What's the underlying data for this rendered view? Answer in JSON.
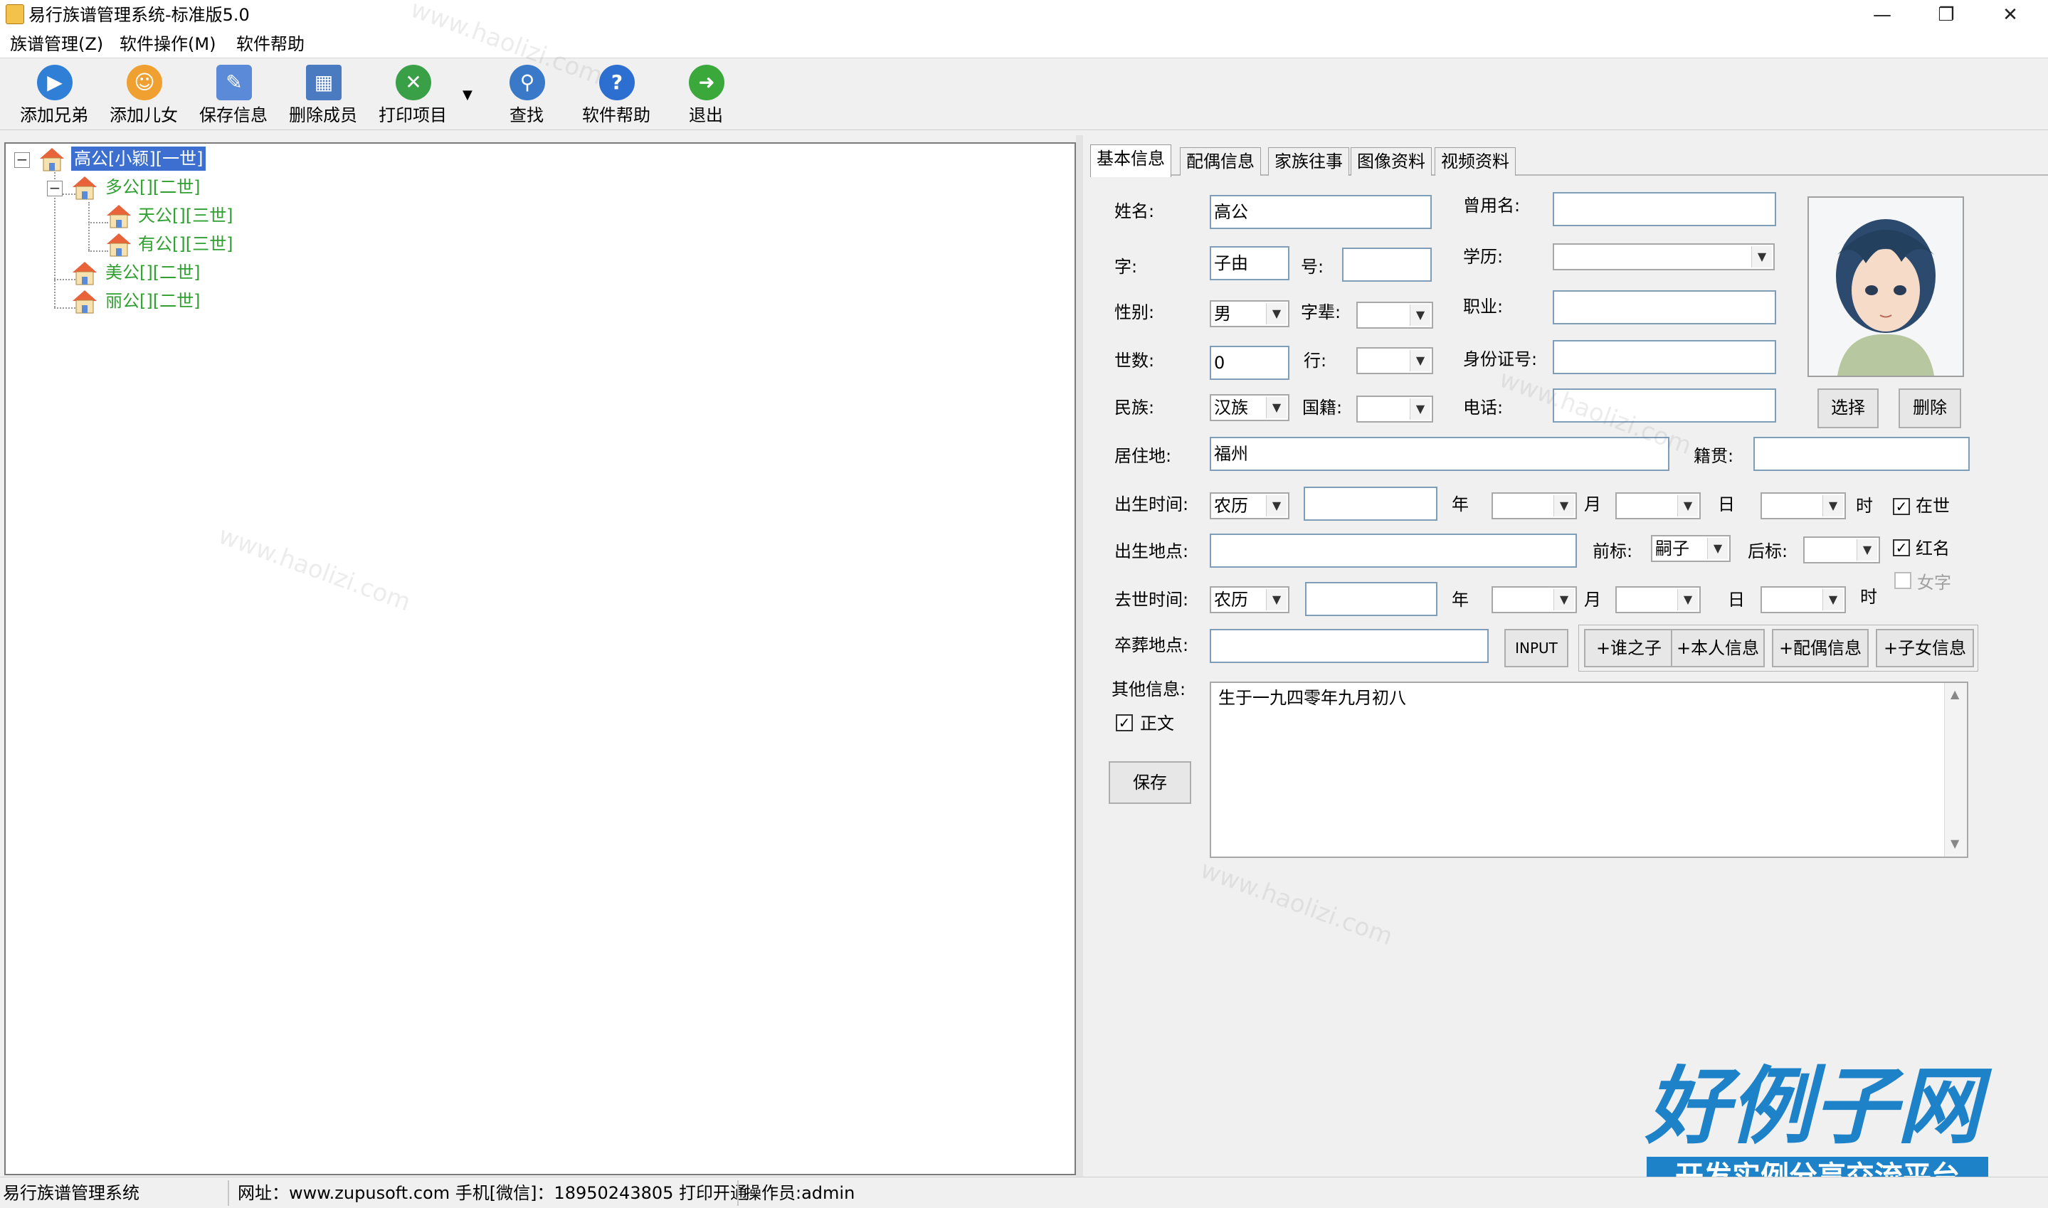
{
  "window": {
    "title": "易行族谱管理系统-标准版5.0"
  },
  "menu": [
    "族谱管理(Z)",
    "软件操作(M)",
    "软件帮助"
  ],
  "toolbar": {
    "buttons": [
      {
        "label": "添加兄弟",
        "icon": "play-circle-icon",
        "color": "#2f7fd6"
      },
      {
        "label": "添加儿女",
        "icon": "user-add-icon",
        "color": "#f0a030"
      },
      {
        "label": "保存信息",
        "icon": "edit-pencil-icon",
        "color": "#5a8ad8"
      },
      {
        "label": "删除成员",
        "icon": "grid-delete-icon",
        "color": "#4a7ac0"
      },
      {
        "label": "打印项目",
        "icon": "print-tools-icon",
        "color": "#3aa048"
      },
      {
        "label": "查找",
        "icon": "search-globe-icon",
        "color": "#3a78c8"
      },
      {
        "label": "软件帮助",
        "icon": "help-icon",
        "color": "#2d6fd0"
      },
      {
        "label": "退出",
        "icon": "exit-arrow-icon",
        "color": "#3aa83a"
      }
    ]
  },
  "tree": {
    "nodes": [
      {
        "label": "高公[小颖][一世]",
        "selected": true
      },
      {
        "label": "多公[][二世]"
      },
      {
        "label": "天公[][三世]"
      },
      {
        "label": "有公[][三世]"
      },
      {
        "label": "美公[][二世]"
      },
      {
        "label": "丽公[][二世]"
      }
    ]
  },
  "tabs": [
    "基本信息",
    "配偶信息",
    "家族往事",
    "图像资料",
    "视频资料"
  ],
  "form": {
    "labels": {
      "name": "姓名:",
      "used_name": "曾用名:",
      "zi": "字:",
      "hao": "号:",
      "education": "学历:",
      "gender": "性别:",
      "zibei": "字辈:",
      "job": "职业:",
      "generation": "世数:",
      "hang": "行:",
      "idcard": "身份证号:",
      "ethnic": "民族:",
      "nationality": "国籍:",
      "phone": "电话:",
      "residence": "居住地:",
      "native": "籍贯:",
      "birth_time": "出生时间:",
      "year": "年",
      "month": "月",
      "day": "日",
      "hour": "时",
      "alive": "在世",
      "birth_place": "出生地点:",
      "prefix": "前标:",
      "suffix": "后标:",
      "red_name": "红名",
      "female": "女字",
      "death_time": "去世时间:",
      "burial": "卒葬地点:",
      "other": "其他信息:",
      "main_text": "正文"
    },
    "values": {
      "name": "高公",
      "used_name": "",
      "zi": "子由",
      "hao": "",
      "education": "",
      "gender": "男",
      "zibei": "",
      "job": "",
      "generation": "0",
      "hang": "",
      "idcard": "",
      "ethnic": "汉族",
      "nationality": "",
      "phone": "",
      "residence": "福州",
      "native": "",
      "birth_calendar": "农历",
      "birth_date": "",
      "birth_year": "",
      "birth_month": "",
      "birth_day": "",
      "birth_hour": "",
      "birth_place": "",
      "prefix": "嗣子",
      "suffix": "",
      "death_calendar": "农历",
      "death_date": "",
      "death_year": "",
      "death_month": "",
      "death_day": "",
      "death_hour": "",
      "burial": "",
      "other_info": "生于一九四零年九月初八"
    },
    "checks": {
      "alive": true,
      "red_name": true,
      "female": false,
      "main_text": true
    },
    "buttons": {
      "select": "选择",
      "delete": "删除",
      "input": "INPUT",
      "add_who": "+谁之子",
      "add_self": "+本人信息",
      "add_spouse": "+配偶信息",
      "add_children": "+子女信息",
      "save": "保存"
    }
  },
  "status": {
    "app": "易行族谱管理系统",
    "contact": "网址：www.zupusoft.com 手机[微信]：18950243805 打印开通",
    "operator": "操作员:admin"
  },
  "watermark": {
    "text": "www.haolizi.com",
    "brand_title": "好例子网",
    "brand_sub": "开发实例分享交流平台"
  }
}
